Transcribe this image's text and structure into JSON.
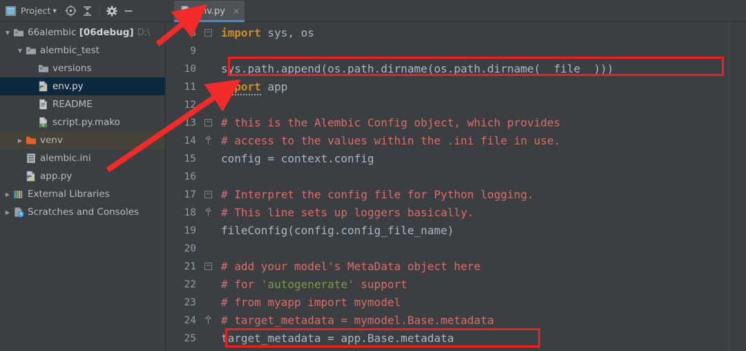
{
  "window": {
    "toolwindow_title": "Project",
    "toolbar_icons": [
      "project-view-icon",
      "locate-target-icon",
      "collapse-all-icon",
      "settings-gear-icon",
      "minimize-icon"
    ]
  },
  "tabs": [
    {
      "label": "env.py",
      "icon": "python-file-icon",
      "close": "×",
      "active": true
    }
  ],
  "tree": [
    {
      "label": "66alembic",
      "bold": "[06debug]",
      "sub": "D:\\",
      "icon": "folder-icon",
      "arrow": "▼",
      "indent": 0,
      "state": "normal"
    },
    {
      "label": "alembic_test",
      "icon": "folder-icon",
      "arrow": "▼",
      "indent": 1,
      "state": "normal"
    },
    {
      "label": "versions",
      "icon": "folder-icon",
      "arrow": "",
      "indent": 2,
      "state": "normal"
    },
    {
      "label": "env.py",
      "icon": "python-file-icon",
      "arrow": "",
      "indent": 2,
      "state": "selected"
    },
    {
      "label": "README",
      "icon": "text-file-icon",
      "arrow": "",
      "indent": 2,
      "state": "normal"
    },
    {
      "label": "script.py.mako",
      "icon": "mako-file-icon",
      "arrow": "",
      "indent": 2,
      "state": "normal"
    },
    {
      "label": "venv",
      "icon": "orange-folder-icon",
      "arrow": "▶",
      "indent": 1,
      "state": "hover"
    },
    {
      "label": "alembic.ini",
      "icon": "ini-file-icon",
      "arrow": "",
      "indent": 1,
      "state": "normal"
    },
    {
      "label": "app.py",
      "icon": "python-file-icon",
      "arrow": "",
      "indent": 1,
      "state": "normal"
    },
    {
      "label": "External Libraries",
      "icon": "libraries-icon",
      "arrow": "▶",
      "indent": 0,
      "state": "normal"
    },
    {
      "label": "Scratches and Consoles",
      "icon": "scratches-icon",
      "arrow": "▶",
      "indent": 0,
      "state": "normal"
    }
  ],
  "editor": {
    "file": "env.py",
    "first_line_number": 8,
    "lines": [
      {
        "n": "8",
        "text": "import sys, os",
        "kind": "code-import",
        "fold": "box"
      },
      {
        "n": "9",
        "text": "",
        "kind": "blank",
        "fold": ""
      },
      {
        "n": "10",
        "text": "sys.path.append(os.path.dirname(os.path.dirname(__file__)))",
        "kind": "code",
        "fold": ""
      },
      {
        "n": "11",
        "text": "import app",
        "kind": "code-import2",
        "fold": ""
      },
      {
        "n": "12",
        "text": "",
        "kind": "blank",
        "fold": ""
      },
      {
        "n": "13",
        "text": "# this is the Alembic Config object, which provides",
        "kind": "comment",
        "fold": "box"
      },
      {
        "n": "14",
        "text": "# access to the values within the .ini file in use.",
        "kind": "comment",
        "fold": "cap"
      },
      {
        "n": "15",
        "text": "config = context.config",
        "kind": "code",
        "fold": ""
      },
      {
        "n": "16",
        "text": "",
        "kind": "blank",
        "fold": ""
      },
      {
        "n": "17",
        "text": "# Interpret the config file for Python logging.",
        "kind": "comment",
        "fold": "box"
      },
      {
        "n": "18",
        "text": "# This line sets up loggers basically.",
        "kind": "comment",
        "fold": "cap"
      },
      {
        "n": "19",
        "text": "fileConfig(config.config_file_name)",
        "kind": "code",
        "fold": ""
      },
      {
        "n": "20",
        "text": "",
        "kind": "blank",
        "fold": ""
      },
      {
        "n": "21",
        "text": "# add your model's MetaData object here",
        "kind": "comment",
        "fold": "box"
      },
      {
        "n": "22",
        "text": "# for 'autogenerate' support",
        "kind": "comment-str",
        "fold": ""
      },
      {
        "n": "23",
        "text": "# from myapp import mymodel",
        "kind": "comment",
        "fold": ""
      },
      {
        "n": "24",
        "text": "# target_metadata = mymodel.Base.metadata",
        "kind": "comment",
        "fold": "cap"
      },
      {
        "n": "25",
        "text": "target_metadata = app.Base.metadata",
        "kind": "code",
        "fold": ""
      }
    ]
  },
  "annotations": {
    "highlight_color": "#f02020",
    "boxes": [
      {
        "name": "highlight-line-10",
        "target_line": "10"
      },
      {
        "name": "highlight-line-25",
        "target_line": "25"
      }
    ],
    "arrows": [
      {
        "name": "arrow-to-tab",
        "points_to": "env.py tab"
      },
      {
        "name": "arrow-to-import-app",
        "points_to": "import app (line 11)"
      }
    ]
  }
}
